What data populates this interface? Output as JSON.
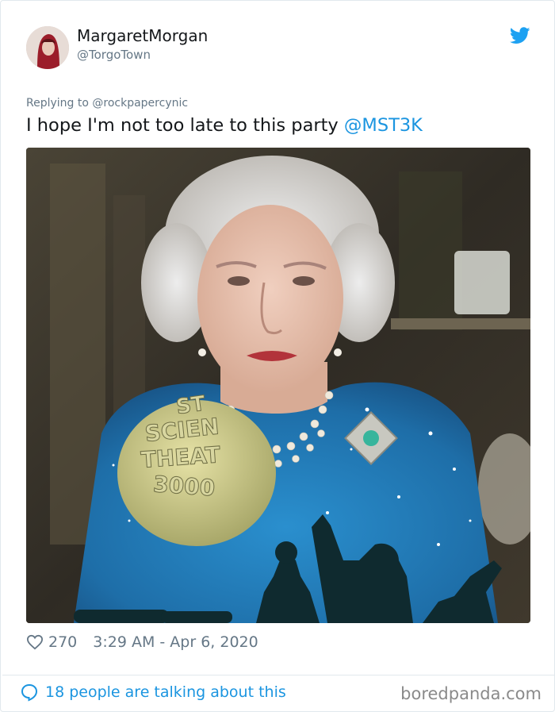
{
  "user": {
    "display_name": "MargaretMorgan",
    "handle": "@TorgoTown"
  },
  "reply": {
    "prefix": "Replying to",
    "target": "@rockpapercynic"
  },
  "tweet": {
    "text": "I hope I'm not too late to this party",
    "mention": "@MST3K"
  },
  "photo_text": {
    "line1": "ST",
    "line2": "SCIEN",
    "line3": "THEAT",
    "line4": "3000"
  },
  "meta": {
    "likes": "270",
    "timestamp": "3:29 AM - Apr 6, 2020"
  },
  "footer": {
    "talking": "18 people are talking about this",
    "watermark": "boredpanda.com"
  },
  "colors": {
    "link": "#1b95e0",
    "muted": "#657786",
    "text": "#14171a"
  },
  "icons": {
    "brand": "twitter-bird-icon",
    "like": "heart-icon",
    "talk": "speech-bubble-icon"
  }
}
